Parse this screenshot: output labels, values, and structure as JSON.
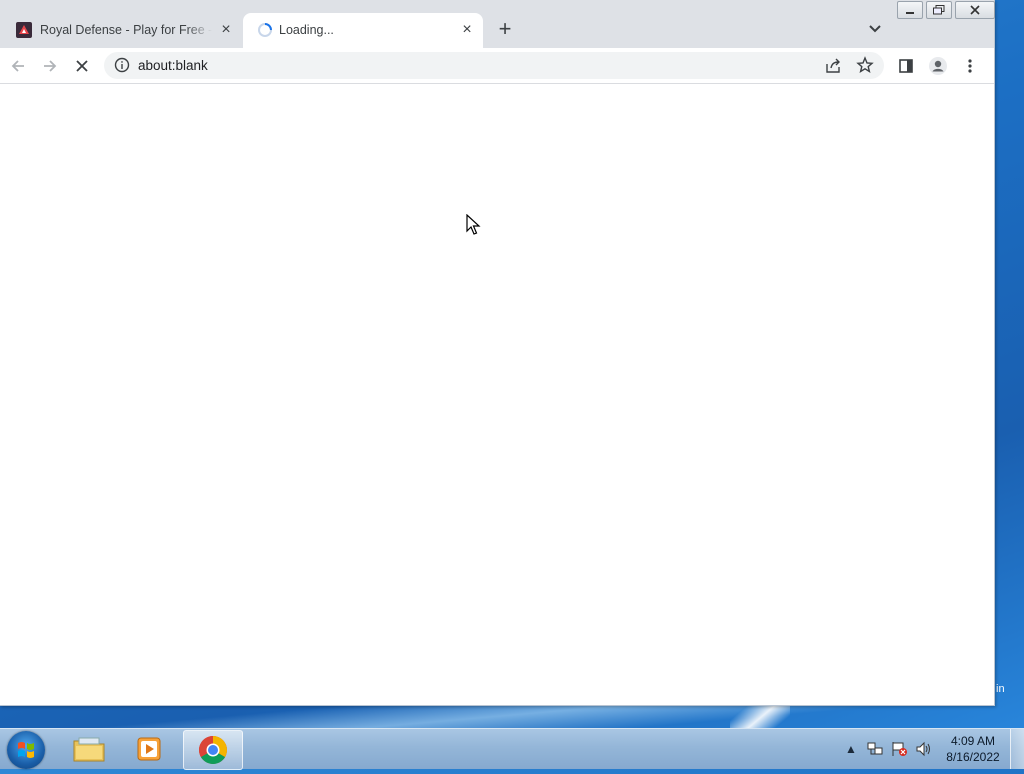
{
  "browser": {
    "tabs": [
      {
        "title": "Royal Defense - Play for Free - G",
        "active": false
      },
      {
        "title": "Loading...",
        "active": true
      }
    ],
    "close_symbol": "×",
    "new_tab_symbol": "+",
    "url": "about:blank",
    "window_controls": {
      "minimize": "—",
      "maximize": "☐",
      "close": "✕"
    }
  },
  "desktop": {
    "edge_text": "in"
  },
  "taskbar": {
    "apps": [
      {
        "name": "windows-explorer"
      },
      {
        "name": "media-player"
      },
      {
        "name": "chrome",
        "active": true
      }
    ],
    "tray": {
      "show_hidden": "▲"
    },
    "clock": {
      "time": "4:09 AM",
      "date": "8/16/2022"
    }
  },
  "colors": {
    "tabstrip": "#dee1e6",
    "omnibox": "#f1f3f4",
    "taskbar": "#94b6d8"
  }
}
